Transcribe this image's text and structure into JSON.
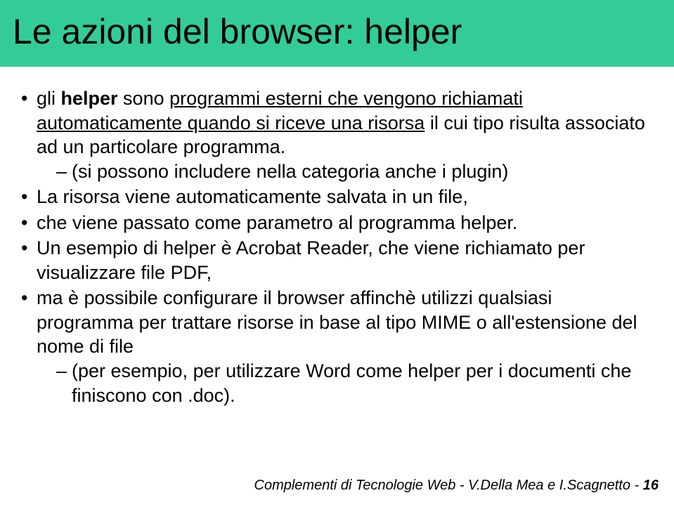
{
  "title": "Le azioni del browser: helper",
  "bullets": {
    "b1a": "gli ",
    "b1b": "helper",
    "b1c": " sono ",
    "b1d": "programmi esterni che vengono richiamati automaticamente quando si riceve una risorsa",
    "b1e": " il cui tipo risulta associato ad un particolare programma.",
    "b1sub1": "(si possono includere nella categoria anche i plugin)",
    "b2": "La risorsa viene automaticamente salvata in un file,",
    "b3": "che viene passato come parametro al programma helper.",
    "b4": "Un esempio di helper è Acrobat Reader, che viene richiamato per visualizzare file PDF,",
    "b5": "ma è possibile configurare il browser affinchè utilizzi qualsiasi programma per trattare risorse in base al tipo MIME o all'estensione del nome di file",
    "b5sub1": "(per esempio, per utilizzare Word come helper per i documenti che finiscono con .doc)."
  },
  "footer": {
    "text": "Complementi di Tecnologie Web - V.Della Mea e I.Scagnetto - ",
    "page": "16"
  }
}
